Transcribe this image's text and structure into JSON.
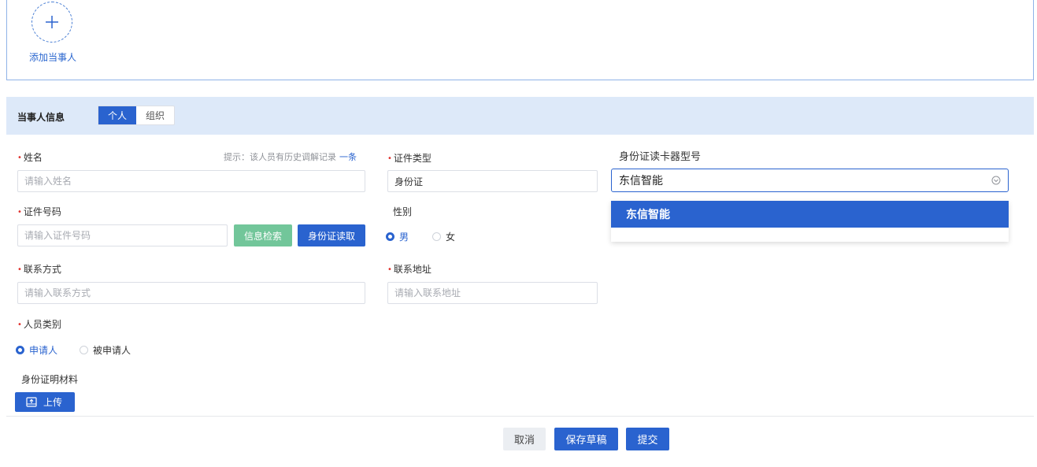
{
  "add_party": {
    "label": "添加当事人",
    "icon": "plus-icon"
  },
  "section": {
    "title": "当事人信息",
    "tabs": [
      {
        "label": "个人",
        "active": true
      },
      {
        "label": "组织",
        "active": false
      }
    ]
  },
  "form": {
    "name": {
      "label": "姓名",
      "placeholder": "请输入姓名",
      "hint": "提示：该人员有历史调解记录",
      "hint_link": "一条"
    },
    "id_type": {
      "label": "证件类型",
      "value": "身份证"
    },
    "reader_model": {
      "label": "身份证读卡器型号",
      "value": "东信智能",
      "options": [
        "东信智能"
      ]
    },
    "id_number": {
      "label": "证件号码",
      "placeholder": "请输入证件号码",
      "search_button": "信息检索",
      "read_button": "身份证读取"
    },
    "gender": {
      "label": "性别",
      "options": [
        "男",
        "女"
      ],
      "selected": "男"
    },
    "contact": {
      "label": "联系方式",
      "placeholder": "请输入联系方式"
    },
    "address": {
      "label": "联系地址",
      "placeholder": "请输入联系地址"
    },
    "person_type": {
      "label": "人员类别",
      "options": [
        "申请人",
        "被申请人"
      ],
      "selected": "申请人"
    },
    "id_material": {
      "label": "身份证明材料",
      "upload_button": "上传"
    }
  },
  "footer": {
    "cancel": "取消",
    "save_draft": "保存草稿",
    "submit": "提交"
  },
  "colors": {
    "primary": "#2a63cf",
    "success": "#72c69a",
    "required": "#e0332f",
    "header_bg": "#dde9f9"
  }
}
